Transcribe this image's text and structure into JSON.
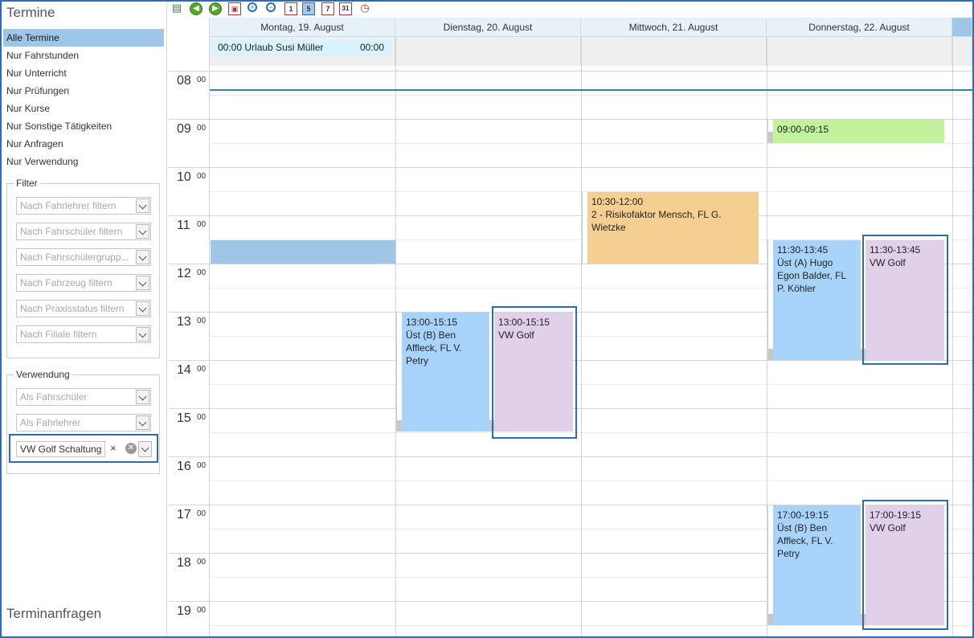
{
  "left_panel": {
    "title": "Termine",
    "nav_items": [
      {
        "label": "Alle Termine",
        "active": true
      },
      {
        "label": "Nur Fahrstunden"
      },
      {
        "label": "Nur Unterricht"
      },
      {
        "label": "Nur Prüfungen"
      },
      {
        "label": "Nur Kurse"
      },
      {
        "label": "Nur Sonstige Tätigkeiten"
      },
      {
        "label": "Nur Anfragen"
      },
      {
        "label": "Nur Verwendung"
      }
    ],
    "filter": {
      "label": "Filter",
      "fields": [
        "Nach Fahrlehrer filtern",
        "Nach Fahrschüler filtern",
        "Nach Fahrschülergrupp...",
        "Nach Fahrzeug filtern",
        "Nach Praxisstatus filtern",
        "Nach Filiale filtern"
      ]
    },
    "verwendung": {
      "label": "Verwendung",
      "fields": [
        "Als Fahrschüler",
        "Als Fahrlehrer"
      ],
      "selected_token": "VW Golf Schaltung",
      "token_remove": "×",
      "clear_symbol": "⊗"
    },
    "footer": "Terminanfragen"
  },
  "toolbar": {
    "icons": [
      "new-appointment-icon",
      "back-icon",
      "forward-icon",
      "today-icon",
      "zoom-in-icon",
      "zoom-out-icon",
      "day-view-icon",
      "workweek-view-icon",
      "week-view-icon",
      "month-view-icon",
      "timeline-icon"
    ],
    "day_label": "1",
    "workweek_label": "5",
    "week_label": "7",
    "month_label": "31"
  },
  "calendar": {
    "days": [
      "Montag, 19. August",
      "Dienstag, 20. August",
      "Mittwoch, 21. August",
      "Donnerstag, 22. August"
    ],
    "allday_event": {
      "start": "00:00",
      "title": "Urlaub Susi Müller",
      "end": "00:00"
    },
    "hours": [
      {
        "h": "08",
        "m": "00"
      },
      {
        "h": "09",
        "m": "00"
      },
      {
        "h": "10",
        "m": "00"
      },
      {
        "h": "11",
        "m": "00"
      },
      {
        "h": "12",
        "m": "00"
      },
      {
        "h": "13",
        "m": "00"
      },
      {
        "h": "14",
        "m": "00"
      },
      {
        "h": "15",
        "m": "00"
      },
      {
        "h": "16",
        "m": "00"
      },
      {
        "h": "17",
        "m": "00"
      },
      {
        "h": "18",
        "m": "00"
      },
      {
        "h": "19",
        "m": "00"
      }
    ],
    "events": {
      "tue_uest": {
        "time": "13:00-15:15",
        "text": "Üst (B) Ben Affleck, FL V. Petry"
      },
      "tue_vw": {
        "time": "13:00-15:15",
        "text": "VW Golf"
      },
      "wed_theory": {
        "time": "10:30-12:00",
        "text": "2 - Risikofaktor Mensch, FL G. Wietzke"
      },
      "thu_green": {
        "time": "09:00-09:15"
      },
      "thu_uest1": {
        "time": "11:30-13:45",
        "text": "Üst (A) Hugo Egon Balder, FL P. Köhler"
      },
      "thu_vw1": {
        "time": "11:30-13:45",
        "text": "VW Golf"
      },
      "thu_uest2": {
        "time": "17:00-19:15",
        "text": "Üst (B) Ben Affleck, FL V. Petry"
      },
      "thu_vw2": {
        "time": "17:00-19:15",
        "text": "VW Golf"
      }
    }
  },
  "colors": {
    "accent": "#2d6cb0",
    "selected_nav": "#9ec6e6",
    "lesson_blue": "#a8d4fb",
    "vehicle_purple": "#e0d0e9",
    "green": "#c3f29d",
    "theory_orange": "#f5cf8f"
  }
}
